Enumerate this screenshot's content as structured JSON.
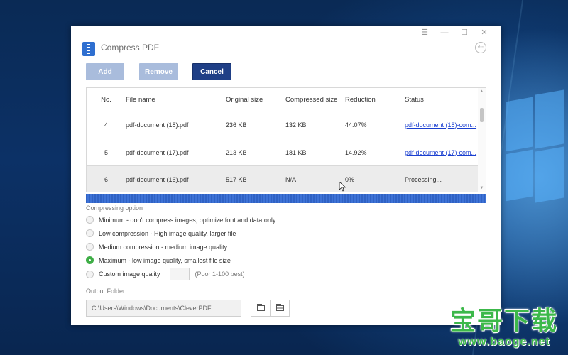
{
  "window": {
    "title": "Compress PDF",
    "controls": [
      "☰",
      "—",
      "☐",
      "✕"
    ],
    "back_icon": "⇠"
  },
  "toolbar": {
    "add_label": "Add",
    "remove_label": "Remove",
    "cancel_label": "Cancel"
  },
  "table": {
    "headers": [
      "No.",
      "File name",
      "Original size",
      "Compressed size",
      "Reduction",
      "Status"
    ],
    "rows": [
      {
        "no": "4",
        "name": "pdf-document (18).pdf",
        "original": "236 KB",
        "compressed": "132 KB",
        "reduction": "44.07%",
        "status": "pdf-document (18)-com...",
        "status_is_link": true
      },
      {
        "no": "5",
        "name": "pdf-document (17).pdf",
        "original": "213 KB",
        "compressed": "181 KB",
        "reduction": "14.92%",
        "status": "pdf-document (17)-com...",
        "status_is_link": true
      },
      {
        "no": "6",
        "name": "pdf-document (16).pdf",
        "original": "517 KB",
        "compressed": "N/A",
        "reduction": "0%",
        "status": "Processing...",
        "status_is_link": false
      }
    ]
  },
  "progress": {
    "percent": 100
  },
  "compressing": {
    "label": "Compressing option",
    "options": [
      {
        "label": "Minimum - don't compress images, optimize font and data only",
        "checked": false
      },
      {
        "label": "Low compression - High image quality, larger file",
        "checked": false
      },
      {
        "label": "Medium compression - medium image quality",
        "checked": false
      },
      {
        "label": "Maximum - low image quality, smallest file size",
        "checked": true
      },
      {
        "label": "Custom image quality",
        "checked": false
      }
    ],
    "custom_hint": "(Poor 1-100 best)"
  },
  "output": {
    "label": "Output Folder",
    "path": "C:\\Users\\Windows\\Documents\\CleverPDF"
  },
  "watermark": {
    "chars": "宝哥下载",
    "url": "www.baoge.net"
  },
  "colors": {
    "accent": "#1f3f86",
    "button_disabled": "#a9bcdc",
    "link": "#1a3fd0",
    "radio_checked": "#3fae47",
    "progress": "#2f62c4"
  }
}
